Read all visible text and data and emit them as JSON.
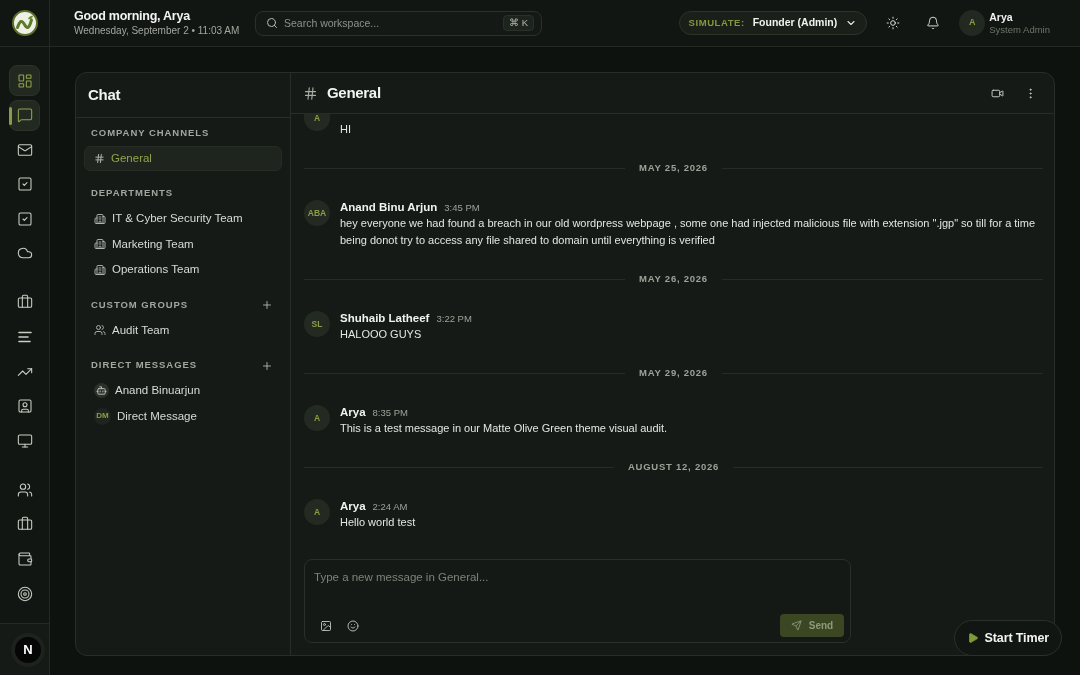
{
  "header": {
    "greeting": "Good morning, Arya",
    "date": "Wednesday, September 2 • 11:03 AM",
    "search": {
      "placeholder": "Search workspace...",
      "shortcut": "⌘ K"
    },
    "simulate": {
      "label": "SIMULATE:",
      "value": "Founder (Admin)"
    },
    "user": {
      "initials": "A",
      "name": "Arya",
      "role": "System Admin"
    }
  },
  "nav_rail": {
    "groups": [
      {
        "items": [
          {
            "highlighted": true,
            "selected": false
          },
          {
            "highlighted": true,
            "selected": true
          },
          {
            "highlighted": false,
            "selected": false
          },
          {
            "highlighted": false,
            "selected": false
          },
          {
            "highlighted": false,
            "selected": false
          },
          {
            "highlighted": false,
            "selected": false
          }
        ]
      },
      {
        "items": [
          {
            "highlighted": false,
            "selected": false
          },
          {
            "highlighted": false,
            "selected": false
          },
          {
            "highlighted": false,
            "selected": false
          },
          {
            "highlighted": false,
            "selected": false
          },
          {
            "highlighted": false,
            "selected": false
          }
        ]
      },
      {
        "items": [
          {
            "highlighted": false,
            "selected": false
          },
          {
            "highlighted": false,
            "selected": false
          },
          {
            "highlighted": false,
            "selected": false
          },
          {
            "highlighted": false,
            "selected": false
          }
        ]
      }
    ],
    "dev_tools": {
      "label": "N"
    }
  },
  "chat_sidebar": {
    "title": "Chat",
    "sections": [
      {
        "title": "COMPANY CHANNELS",
        "add_button": false,
        "items": [
          {
            "kind": "channel",
            "label": "General",
            "selected": true
          }
        ]
      },
      {
        "title": "DEPARTMENTS",
        "add_button": false,
        "items": [
          {
            "kind": "department",
            "label": "IT & Cyber Security Team",
            "selected": false
          },
          {
            "kind": "department",
            "label": "Marketing Team",
            "selected": false
          },
          {
            "kind": "department",
            "label": "Operations Team",
            "selected": false
          }
        ]
      },
      {
        "title": "CUSTOM GROUPS",
        "add_button": true,
        "items": [
          {
            "kind": "group",
            "label": "Audit Team",
            "selected": false
          }
        ]
      },
      {
        "title": "DIRECT MESSAGES",
        "add_button": true,
        "items": [
          {
            "kind": "bot",
            "label": "Anand Binuarjun",
            "selected": false
          },
          {
            "kind": "dm",
            "initials": "DM",
            "label": "Direct Message",
            "selected": false
          }
        ]
      }
    ]
  },
  "channel": {
    "title": "General",
    "messages": [
      {
        "kind": "partial",
        "avatar": "A",
        "text": "HI"
      },
      {
        "kind": "date",
        "label": "MAY 25, 2026"
      },
      {
        "kind": "message",
        "avatar": "ABA",
        "author": "Anand Binu Arjun",
        "time": "3:45 PM",
        "text": "hey everyone we had found a breach in our old wordpress webpage , some one had injected malicious file with extension \".jgp\" so till for a time being donot try to access any file shared to domain until everything is verified"
      },
      {
        "kind": "date",
        "label": "MAY 26, 2026"
      },
      {
        "kind": "message",
        "avatar": "SL",
        "author": "Shuhaib Latheef",
        "time": "3:22 PM",
        "text": "HALOOO GUYS"
      },
      {
        "kind": "date",
        "label": "MAY 29, 2026"
      },
      {
        "kind": "message",
        "avatar": "A",
        "author": "Arya",
        "time": "8:35 PM",
        "text": "This is a test message in our Matte Olive Green theme visual audit."
      },
      {
        "kind": "date",
        "label": "AUGUST 12, 2026"
      },
      {
        "kind": "message",
        "avatar": "A",
        "author": "Arya",
        "time": "2:24 AM",
        "text": "Hello world test"
      }
    ],
    "composer": {
      "placeholder": "Type a new message in General...",
      "send": {
        "label": "Send",
        "disabled": true
      }
    }
  },
  "timer": {
    "label": "Start Timer"
  }
}
